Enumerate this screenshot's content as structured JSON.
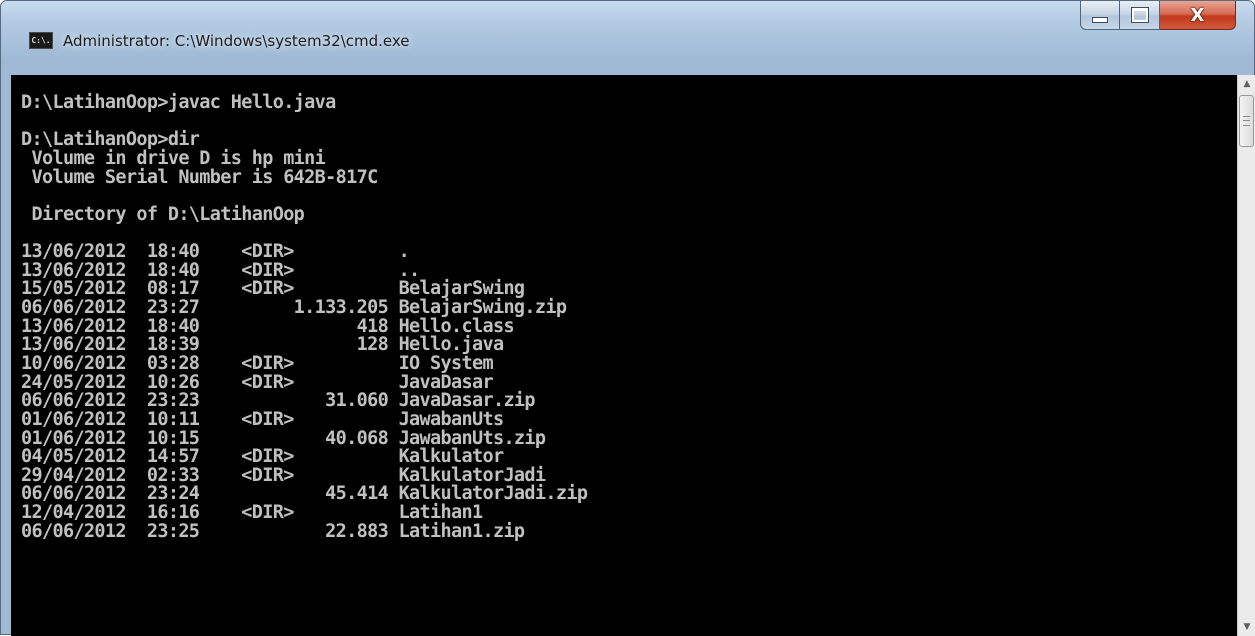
{
  "window": {
    "title": "Administrator: C:\\Windows\\system32\\cmd.exe",
    "icon_label": "C:\\.",
    "icon": "cmd-icon",
    "buttons": {
      "minimize": "minimize-icon",
      "maximize": "maximize-icon",
      "close_glyph": "X"
    }
  },
  "console": {
    "lines": [
      "D:\\LatihanOop>javac Hello.java",
      "",
      "D:\\LatihanOop>dir",
      " Volume in drive D is hp mini",
      " Volume Serial Number is 642B-817C",
      "",
      " Directory of D:\\LatihanOop",
      "",
      "13/06/2012  18:40    <DIR>          .",
      "13/06/2012  18:40    <DIR>          ..",
      "15/05/2012  08:17    <DIR>          BelajarSwing",
      "06/06/2012  23:27         1.133.205 BelajarSwing.zip",
      "13/06/2012  18:40               418 Hello.class",
      "13/06/2012  18:39               128 Hello.java",
      "10/06/2012  03:28    <DIR>          IO System",
      "24/05/2012  10:26    <DIR>          JavaDasar",
      "06/06/2012  23:23            31.060 JavaDasar.zip",
      "01/06/2012  10:11    <DIR>          JawabanUts",
      "01/06/2012  10:15            40.068 JawabanUts.zip",
      "04/05/2012  14:57    <DIR>          Kalkulator",
      "29/04/2012  02:33    <DIR>          KalkulatorJadi",
      "06/06/2012  23:24            45.414 KalkulatorJadi.zip",
      "12/04/2012  16:16    <DIR>          Latihan1",
      "06/06/2012  23:25            22.883 Latihan1.zip"
    ]
  },
  "scrollbar": {
    "up_icon": "scroll-up-arrow-icon",
    "down_icon": "scroll-down-arrow-icon",
    "up_glyph": "▲",
    "down_glyph": "▼"
  },
  "colors": {
    "console_bg": "#000000",
    "console_fg": "#c0c0c0",
    "close_button": "#c1391c"
  }
}
